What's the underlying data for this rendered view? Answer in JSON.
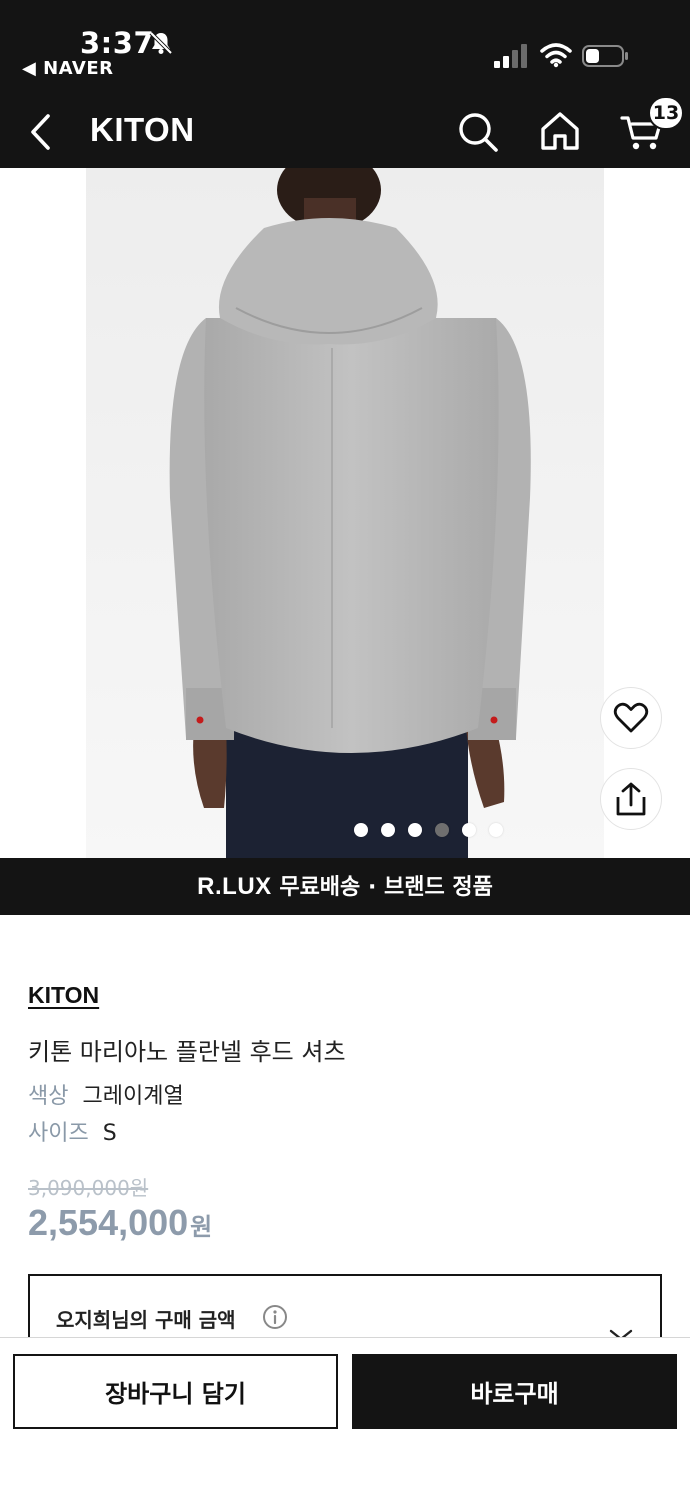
{
  "status_bar": {
    "time": "3:37",
    "back_app": "◀ NAVER"
  },
  "nav": {
    "title": "KITON",
    "cart_count": "13"
  },
  "gallery": {
    "image_count": 6,
    "active_index": 3
  },
  "banner": {
    "brand": "R.LUX",
    "text": " 무료배송 · 브랜드 정품"
  },
  "product": {
    "brand": "KITON",
    "name": "키톤 마리아노 플란넬 후드 셔츠",
    "color_label": "색상",
    "color_value": "그레이계열",
    "size_label": "사이즈",
    "size_value": "S",
    "original_price": "3,090,000원",
    "sale_price": "2,554,000",
    "sale_currency": "원"
  },
  "purchase": {
    "title": "오지희님의 구매 금액"
  },
  "actions": {
    "cart_label": "장바구니 담기",
    "buy_label": "바로구매"
  },
  "colors": {
    "dark": "#141414",
    "price_accent": "#8d9bab",
    "label_gray": "#8a99a8"
  },
  "icons": [
    "bell-slash-icon",
    "signal-icon",
    "wifi-icon",
    "battery-icon",
    "back-chevron-icon",
    "search-icon",
    "home-icon",
    "cart-icon",
    "heart-icon",
    "share-icon",
    "info-icon",
    "chevron-down-icon"
  ]
}
